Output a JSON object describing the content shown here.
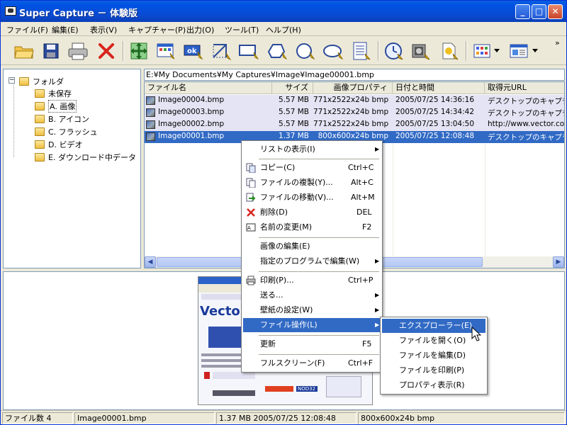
{
  "window": {
    "title": "Super Capture － 体験版",
    "min_label": "_",
    "max_label": "□",
    "close_label": "✕"
  },
  "menubar": {
    "items": [
      "ファイル(F)",
      "編集(E)",
      "表示(V)",
      "キャプチャー(P)",
      "出力(O)",
      "ツール(T)",
      "ヘルプ(H)"
    ]
  },
  "toolbar": {
    "overflow": "»"
  },
  "tree": {
    "root": "フォルダ",
    "items": [
      "未保存",
      "A. 画像",
      "B. アイコン",
      "C. フラッシュ",
      "D. ビデオ",
      "E. ダウンロード中データ"
    ],
    "expander": "−"
  },
  "path": "E:¥My Documents¥My Captures¥Image¥Image00001.bmp",
  "list": {
    "headers": [
      "ファイル名",
      "サイズ",
      "画像プロパティ",
      "日付と時間",
      "取得元URL"
    ],
    "rows": [
      {
        "name": "Image00004.bmp",
        "size": "5.57 MB",
        "props": "771x2522x24b bmp",
        "date": "2005/07/25 14:36:16",
        "url": "デスクトップのキャプチャ"
      },
      {
        "name": "Image00003.bmp",
        "size": "5.57 MB",
        "props": "771x2522x24b bmp",
        "date": "2005/07/25 14:34:42",
        "url": "デスクトップのキャプチャ"
      },
      {
        "name": "Image00002.bmp",
        "size": "5.57 MB",
        "props": "771x2522x24b bmp",
        "date": "2005/07/25 13:04:50",
        "url": "http://www.vector.co"
      },
      {
        "name": "Image00001.bmp",
        "size": "1.37 MB",
        "props": "800x600x24b bmp",
        "date": "2005/07/25 12:08:48",
        "url": "デスクトップのキャプチャ"
      }
    ]
  },
  "context_menu": {
    "items": [
      {
        "label": "リストの表示(I)",
        "shortcut": "",
        "submenu": true
      },
      {
        "label": "コピー(C)",
        "shortcut": "Ctrl+C",
        "submenu": false
      },
      {
        "label": "ファイルの複製(Y)...",
        "shortcut": "Alt+C",
        "submenu": false
      },
      {
        "label": "ファイルの移動(V)...",
        "shortcut": "Alt+M",
        "submenu": false
      },
      {
        "label": "削除(D)",
        "shortcut": "DEL",
        "submenu": false
      },
      {
        "label": "名前の変更(M)",
        "shortcut": "F2",
        "submenu": false
      },
      {
        "label": "画像の編集(E)",
        "shortcut": "",
        "submenu": false
      },
      {
        "label": "指定のプログラムで編集(W)",
        "shortcut": "",
        "submenu": true
      },
      {
        "label": "印刷(P)...",
        "shortcut": "Ctrl+P",
        "submenu": false
      },
      {
        "label": "送る...",
        "shortcut": "",
        "submenu": true
      },
      {
        "label": "壁紙の設定(W)",
        "shortcut": "",
        "submenu": true
      },
      {
        "label": "ファイル操作(L)",
        "shortcut": "",
        "submenu": true
      },
      {
        "label": "更新",
        "shortcut": "F5",
        "submenu": false
      },
      {
        "label": "フルスクリーン(F)",
        "shortcut": "Ctrl+F",
        "submenu": false
      }
    ]
  },
  "submenu": {
    "items": [
      "エクスプローラー(E)",
      "ファイルを開く(O)",
      "ファイルを編集(D)",
      "ファイルを印刷(P)",
      "プロパティ表示(R)"
    ]
  },
  "thumb": {
    "logo": "Vector",
    "badge": "NOD32"
  },
  "status": {
    "count": "ファイル数 4",
    "file": "Image00001.bmp",
    "info": "1.37 MB 2005/07/25 12:08:48",
    "dims": "800x600x24b bmp"
  },
  "colors": {
    "titlebar": "#0053e3",
    "selection": "#316ac5",
    "selection_light": "#e4e4f4"
  }
}
